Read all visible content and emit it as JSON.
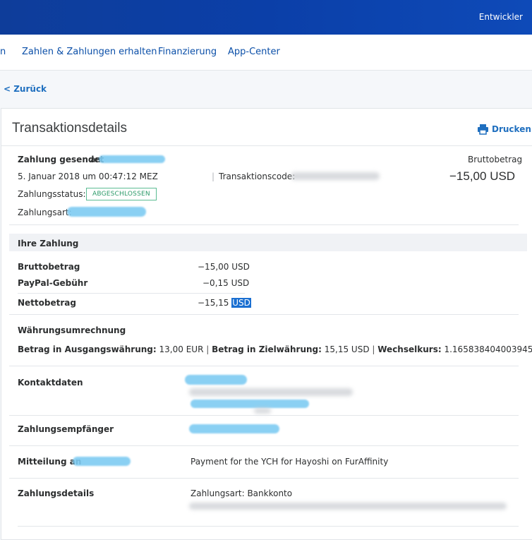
{
  "topbar": {
    "dev_label": "Entwickler"
  },
  "nav": {
    "partial": "n",
    "items": [
      "Zahlen & Zahlungen erhalten",
      "Finanzierung",
      "App-Center"
    ]
  },
  "back_label": "< Zurück",
  "page_title": "Transaktionsdetails",
  "print_label": "Drucken",
  "summary": {
    "sent_label": "Zahlung gesendet",
    "sent_to": "an",
    "date": "5. Januar 2018 um 00:47:12 MEZ",
    "txn_label": "Transaktionscode:",
    "status_label": "Zahlungsstatus:",
    "status_value": "ABGESCHLOSSEN",
    "type_label": "Zahlungsart:",
    "gross_label": "Bruttobetrag",
    "gross_value": "−15,00 USD"
  },
  "your_payment": {
    "header": "Ihre Zahlung",
    "rows": [
      {
        "label": "Bruttobetrag",
        "value": "−15,00 USD"
      },
      {
        "label": "PayPal-Gebühr",
        "value": "−0,15 USD"
      }
    ],
    "net_label": "Nettobetrag",
    "net_amount": "−15,15",
    "net_currency": "USD"
  },
  "conversion": {
    "header": "Währungsumrechnung",
    "src_label": "Betrag in Ausgangswährung:",
    "src_value": "13,00 EUR",
    "dst_label": "Betrag in Zielwährung:",
    "dst_value": "15,15 USD",
    "rate_label": "Wechselkurs:",
    "rate_value": "1.165838404003945"
  },
  "contact": {
    "label": "Kontaktdaten"
  },
  "recipient": {
    "label": "Zahlungsempfänger"
  },
  "message": {
    "label": "Mitteilung an",
    "value": "Payment for the YCH for Hayoshi on FurAffinity"
  },
  "details": {
    "label": "Zahlungsdetails",
    "value": "Zahlungsart: Bankkonto"
  },
  "colors": {
    "brand": "#0b3fa8",
    "link": "#1f6fbf",
    "status": "#2c9a69"
  }
}
